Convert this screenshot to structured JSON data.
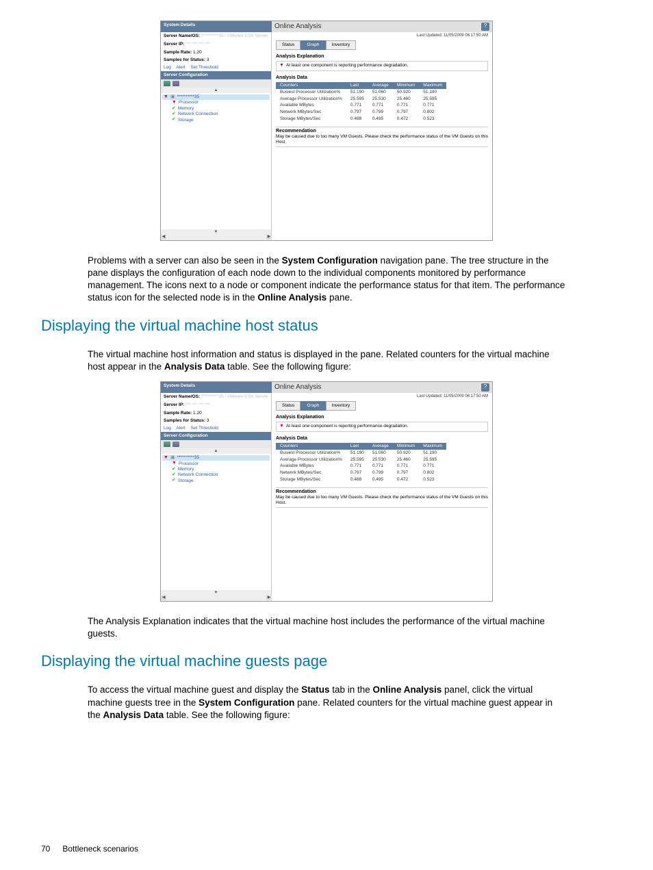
{
  "screenshot": {
    "systemDetailsTitle": "System Details",
    "serverNameOSLabel": "Server Name/OS:",
    "serverNameOSValue": "**********35 / VMware ESX Server",
    "serverIPLabel": "Server IP:",
    "serverIPValue": "***.***.***.***",
    "sampleRateLabel": "Sample Rate:",
    "sampleRateValue": "1.20",
    "samplesForStatusLabel": "Samples for Status:",
    "samplesForStatusValue": "3",
    "linkLog": "Log",
    "linkAlert": "Alert",
    "linkSetThreshold": "Set Threshold",
    "serverConfigTitle": "Server Configuration",
    "tree": {
      "root": "**********35",
      "processor": "Processor",
      "memory": "Memory",
      "network": "Network Connection",
      "storage": "Storage"
    },
    "onlineAnalysisTitle": "Online Analysis",
    "helpIcon": "?",
    "lastUpdatedLabel": "Last Updated:",
    "lastUpdatedValue": "11/05/2009 06:17:50 AM",
    "tabs": {
      "status": "Status",
      "graph": "Graph",
      "inventory": "Inventory"
    },
    "analysisExplanationTitle": "Analysis Explanation",
    "analysisExplanationText": "At least one component is reporting performance degradation.",
    "analysisDataTitle": "Analysis Data",
    "columns": {
      "counters": "Counters",
      "last": "Last",
      "average": "Average",
      "minimum": "Minimum",
      "maximum": "Maximum"
    },
    "rows": [
      {
        "c": "Busiest Processor Utilization%",
        "last": "51.190",
        "avg": "51.060",
        "min": "50.920",
        "max": "51.190"
      },
      {
        "c": "Average Processor Utilization%",
        "last": "25.595",
        "avg": "25.530",
        "min": "25.460",
        "max": "25.595"
      },
      {
        "c": "Available MBytes",
        "last": "0.771",
        "avg": "0.771",
        "min": "0.771",
        "max": "0.771"
      },
      {
        "c": "Network MBytes/Sec",
        "last": "0.797",
        "avg": "0.799",
        "min": "0.797",
        "max": "0.802"
      },
      {
        "c": "Storage MBytes/Sec",
        "last": "0.488",
        "avg": "0.495",
        "min": "0.472",
        "max": "0.523"
      }
    ],
    "recommendationTitle": "Recommendation",
    "recommendationText": "May be caused due to too many VM Guests. Please check the performance status of the VM Guests on this Host."
  },
  "para1": {
    "pre": "Problems with a server can also be seen in the ",
    "b1": "System Configuration",
    "mid": " navigation pane. The tree structure in the pane displays the configuration of each node down to the individual components monitored by performance management. The icons next to a node or component indicate the performance status for that item. The performance status icon for the selected node is in the ",
    "b2": "Online Analysis",
    "post": " pane."
  },
  "heading1": "Displaying the virtual machine host status",
  "para2": {
    "pre": "The virtual machine host information and status is displayed in the pane. Related counters for the virtual machine host appear in the ",
    "b1": "Analysis Data",
    "post": " table. See the following figure:"
  },
  "para3": "The Analysis Explanation indicates that the virtual machine host includes the performance of the virtual machine guests.",
  "heading2": "Displaying the virtual machine guests page",
  "para4": {
    "pre": "To access the virtual machine guest and display the ",
    "b1": "Status",
    "mid1": " tab in the ",
    "b2": "Online Analysis",
    "mid2": " panel, click the virtual machine guests tree in the ",
    "b3": "System Configuration",
    "mid3": " pane. Related counters for the virtual machine guest appear in the ",
    "b4": "Analysis Data",
    "post": " table. See the following figure:"
  },
  "footer": {
    "page": "70",
    "section": "Bottleneck scenarios"
  }
}
